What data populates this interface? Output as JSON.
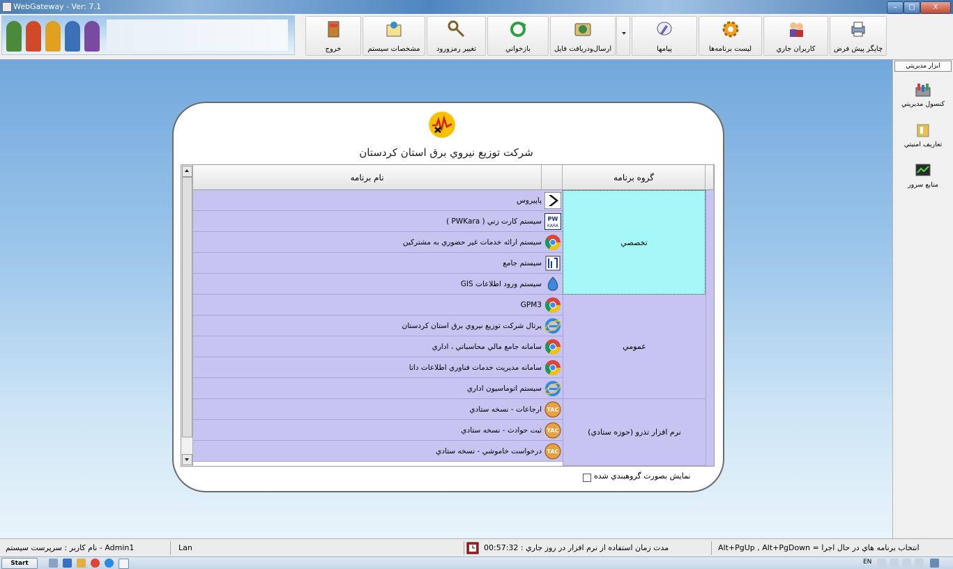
{
  "window": {
    "title": "WebGateway - Ver: 7.1",
    "minimize": "–",
    "maximize": "□",
    "close": "X"
  },
  "toolbar": {
    "buttons": [
      {
        "label": "چاپگر پيش فرض",
        "icon": "printer-icon"
      },
      {
        "label": "كاربران جاري",
        "icon": "users-icon"
      },
      {
        "label": "ليست برنامه‌ها",
        "icon": "gear-icon"
      },
      {
        "label": "پيامها",
        "icon": "message-icon"
      },
      {
        "label": "ارسال‌ودريافت فايل",
        "icon": "file-transfer-icon"
      },
      {
        "label": "بازخواني",
        "icon": "refresh-icon"
      },
      {
        "label": "تغيير رمزورود",
        "icon": "keys-icon"
      },
      {
        "label": "مشخصات سيستم",
        "icon": "system-info-icon"
      },
      {
        "label": "خروج",
        "icon": "exit-door-icon"
      }
    ]
  },
  "side_panel": {
    "title": "ابزار مديريتي",
    "items": [
      {
        "label": "كنسول مديريتي",
        "icon": "admin-console-icon"
      },
      {
        "label": "تعاريف امنيتي",
        "icon": "security-definitions-icon"
      },
      {
        "label": "منابع سرور",
        "icon": "server-resources-icon"
      }
    ]
  },
  "company_name": "شركت توزيع نيروي برق استان كردستان",
  "table": {
    "col_name": "نام برنامه",
    "col_group": "گروه برنامه",
    "groups": [
      {
        "name": "تخصصي",
        "selected": true
      },
      {
        "name": "عمومي",
        "selected": false
      },
      {
        "name": "نرم افزار تذرو (حوزه ستادي)",
        "selected": false
      }
    ],
    "rows": [
      {
        "name": "پاپيروس",
        "icon": "papyrus-arrow-icon"
      },
      {
        "name": "سيستم كارت زني ( PWKara )",
        "icon": "pwkara-icon"
      },
      {
        "name": "سيستم ارائه خدمات غير حضوري به مشتركين",
        "icon": "chrome-icon"
      },
      {
        "name": "سيستم جامع",
        "icon": "jame-system-icon"
      },
      {
        "name": "سيستم ورود اطلاعات GIS",
        "icon": "gis-icon"
      },
      {
        "name": "GPM3",
        "icon": "chrome-icon"
      },
      {
        "name": "پرتال شركت توزيع نيروي برق استان كردستان",
        "icon": "internet-explorer-icon"
      },
      {
        "name": "سامانه جامع مالي محاسباتي ، اداري",
        "icon": "chrome-icon"
      },
      {
        "name": "سامانه مديريت خدمات فناوري اطلاعات داتا",
        "icon": "chrome-icon"
      },
      {
        "name": "سيستم اتوماسيون اداري",
        "icon": "internet-explorer-icon"
      },
      {
        "name": "ارجاعات - نسخه ستادي",
        "icon": "tac-icon"
      },
      {
        "name": "ثبت حوادث - نسخه ستادي",
        "icon": "tac-icon"
      },
      {
        "name": "درخواست خاموشي - نسخه ستادي",
        "icon": "tac-icon"
      }
    ]
  },
  "grouped_view": {
    "label": "نمايش بصورت گروهبندي شده",
    "checked": false
  },
  "status": {
    "user": "Admin1 - نام كاربر : سرپرست سيستم",
    "connection": "Lan",
    "usage_time": "مدت زمان استفاده از نرم افزار در روز جاري : 00:57:32",
    "hotkeys": "انتخاب برنامه هاي در حال اجرا = Alt+PgUp , Alt+PgDown"
  },
  "taskbar": {
    "start": "Start",
    "lang": "EN"
  },
  "colors": {
    "row_bg": "#c8c4f2",
    "selected_group_bg": "#a6f8f8",
    "desktop_top": "#72a8dc"
  }
}
